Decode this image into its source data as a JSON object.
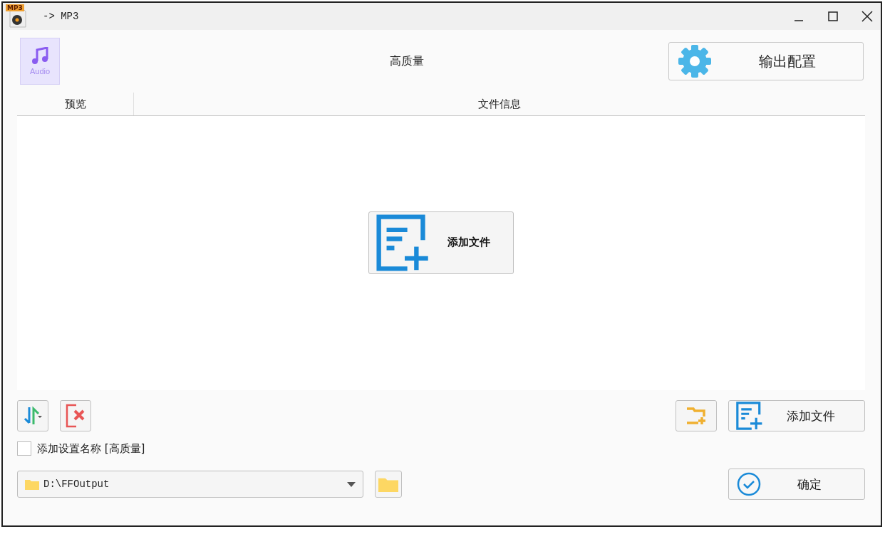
{
  "window": {
    "title": "-> MP3",
    "app_icon_label": "MP3"
  },
  "header": {
    "file_type_label": "Audio",
    "preset": "高质量",
    "output_config_button": "输出配置"
  },
  "table": {
    "columns": [
      "预览",
      "文件信息"
    ],
    "center_button": "添加文件"
  },
  "toolbar": {
    "add_file_button": "添加文件"
  },
  "add_preset_name": {
    "label": "添加设置名称 [高质量]",
    "checked": false
  },
  "output_path": {
    "value": "D:\\FFOutput"
  },
  "confirm_button": "确定"
}
